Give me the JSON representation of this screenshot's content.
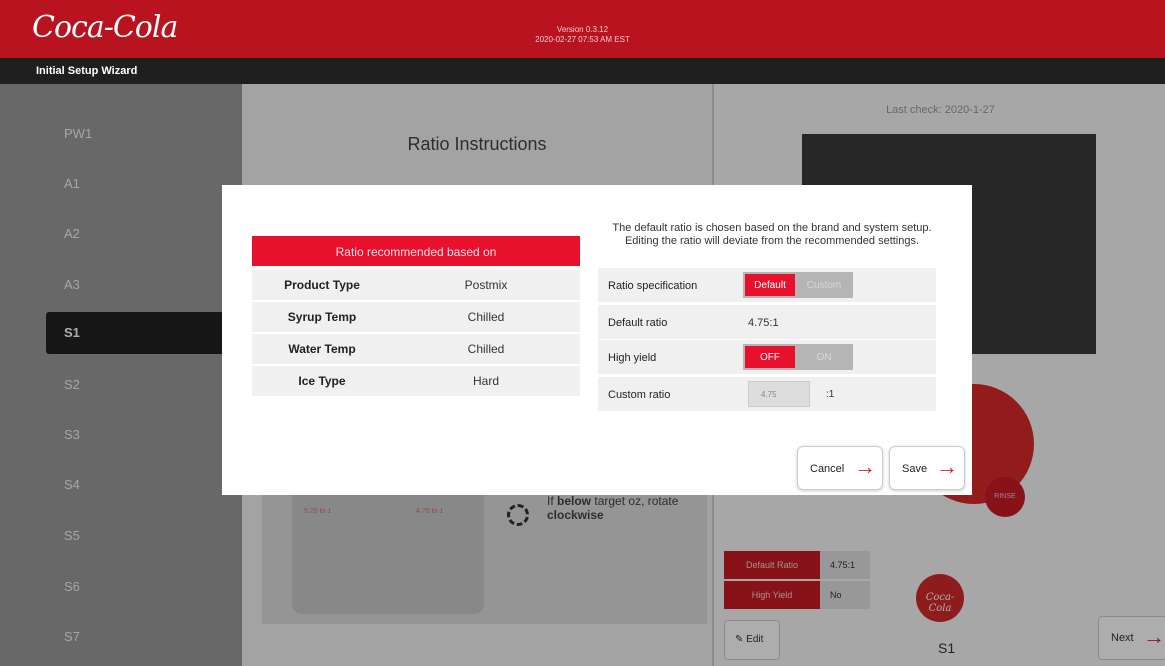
{
  "header": {
    "logo": "Coca-Cola",
    "version": "Version 0.3.12",
    "timestamp": "2020-02-27 07:53 AM EST",
    "wizard_title": "Initial Setup Wizard"
  },
  "sidebar": {
    "items": [
      {
        "label": "PW1"
      },
      {
        "label": "A1"
      },
      {
        "label": "A2"
      },
      {
        "label": "A3"
      },
      {
        "label": "S1"
      },
      {
        "label": "S2"
      },
      {
        "label": "S3"
      },
      {
        "label": "S4"
      },
      {
        "label": "S5"
      },
      {
        "label": "S6"
      },
      {
        "label": "S7"
      }
    ],
    "active": "S1"
  },
  "main": {
    "title": "Ratio Instructions",
    "cup_left_ratio": "5.25 to 1",
    "cup_right_ratio": "4.75 to 1",
    "rotate_text_prefix": "If",
    "rotate_bold": "below",
    "rotate_mid": "target oz, rotate",
    "rotate_bold2": "clockwise"
  },
  "right_panel": {
    "last_check": "Last check: 2020-1-27",
    "rinse": "RINSE",
    "default_ratio_label": "Default Ratio",
    "default_ratio_value": "4.75:1",
    "high_yield_label": "High Yield",
    "high_yield_value": "No",
    "badge": "Coca-Cola",
    "dispenser": "S1",
    "edit_label": "Edit",
    "next_label": "Next"
  },
  "dialog": {
    "recommended_header": "Ratio recommended based on",
    "recommended": [
      {
        "key": "Product Type",
        "value": "Postmix"
      },
      {
        "key": "Syrup Temp",
        "value": "Chilled"
      },
      {
        "key": "Water Temp",
        "value": "Chilled"
      },
      {
        "key": "Ice Type",
        "value": "Hard"
      }
    ],
    "note": "The default ratio is chosen based on the brand and system setup. Editing the ratio will deviate from the recommended settings.",
    "ratio_spec_label": "Ratio specification",
    "ratio_spec_selected": "Default",
    "ratio_spec_other": "Custom",
    "default_ratio_label": "Default ratio",
    "default_ratio_value": "4.75:1",
    "high_yield_label": "High yield",
    "high_yield_selected": "OFF",
    "high_yield_other": "ON",
    "custom_ratio_label": "Custom ratio",
    "custom_ratio_value": "4.75",
    "custom_ratio_suffix": ":1",
    "cancel_label": "Cancel",
    "save_label": "Save"
  },
  "colors": {
    "brand_red": "#b8131f",
    "accent_red": "#e8112d",
    "dark_bar": "#1f1f1f"
  }
}
